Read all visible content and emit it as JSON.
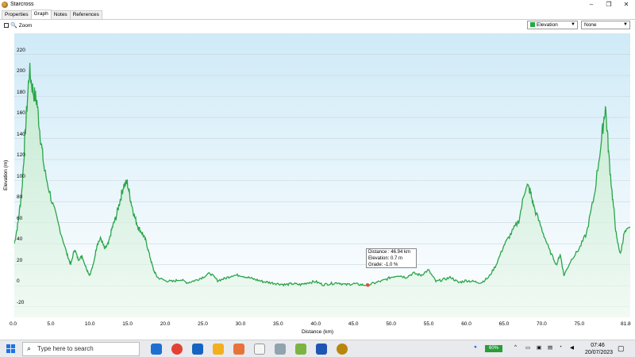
{
  "window": {
    "title": "Starcross"
  },
  "tabs": [
    {
      "label": "Properties"
    },
    {
      "label": "Graph"
    },
    {
      "label": "Notes"
    },
    {
      "label": "References"
    }
  ],
  "toolbar": {
    "zoom_label": "Zoom",
    "series_select": {
      "value": "Elevation",
      "color": "#22aa44"
    },
    "secondary_select": {
      "value": "None"
    }
  },
  "chart_data": {
    "type": "area",
    "xlabel": "Distance  (km)",
    "ylabel": "Elevation (m)",
    "xlim": [
      0,
      81.8
    ],
    "ylim": [
      -30,
      240
    ],
    "x_ticks": [
      "0.0",
      "5.0",
      "10.0",
      "15.0",
      "20.0",
      "25.0",
      "30.0",
      "35.0",
      "40.0",
      "45.0",
      "50.0",
      "55.0",
      "60.0",
      "65.0",
      "70.0",
      "75.0",
      "81.8"
    ],
    "y_ticks": [
      "-20",
      "0",
      "20",
      "40",
      "60",
      "80",
      "100",
      "120",
      "140",
      "160",
      "180",
      "200",
      "220"
    ],
    "grid": true,
    "line_color": "#2aa54a",
    "series": [
      {
        "x": [
          0,
          0.5,
          1,
          1.5,
          2,
          2.5,
          3,
          3.5,
          4,
          5,
          6,
          7,
          7.5,
          8,
          8.5,
          9,
          9.5,
          10,
          10.5,
          11,
          11.5,
          12,
          12.5,
          13,
          13.5,
          14,
          14.5,
          15,
          15.5,
          16,
          16.5,
          17,
          17.5,
          18,
          18.5,
          19,
          20,
          21,
          22,
          23,
          24,
          25,
          26,
          27,
          28,
          29,
          30,
          31,
          32,
          33,
          34,
          35,
          36,
          37,
          38,
          39,
          40,
          41,
          42,
          43,
          44,
          45,
          46,
          46.94,
          48,
          49,
          50,
          51,
          52,
          53,
          54,
          55,
          56,
          57,
          58,
          59,
          60,
          61,
          62,
          63,
          64,
          65,
          66,
          67,
          68,
          68.5,
          69,
          70,
          71,
          72,
          72.5,
          73,
          74,
          75,
          76,
          77,
          78,
          78.5,
          79,
          79.5,
          80,
          80.5,
          81,
          81.8
        ],
        "y": [
          40,
          60,
          90,
          150,
          205,
          185,
          175,
          140,
          110,
          80,
          55,
          30,
          20,
          35,
          25,
          28,
          18,
          10,
          20,
          40,
          45,
          35,
          40,
          55,
          65,
          80,
          95,
          98,
          80,
          65,
          55,
          50,
          42,
          28,
          15,
          8,
          5,
          4,
          6,
          3,
          5,
          8,
          12,
          5,
          7,
          10,
          10,
          8,
          6,
          4,
          3,
          2,
          1,
          2,
          1,
          3,
          4,
          1,
          2,
          3,
          1,
          2,
          1,
          0.7,
          3,
          5,
          8,
          10,
          8,
          12,
          10,
          15,
          4,
          6,
          8,
          3,
          5,
          4,
          3,
          8,
          20,
          38,
          50,
          62,
          97,
          90,
          75,
          55,
          35,
          20,
          30,
          10,
          25,
          35,
          50,
          85,
          140,
          171,
          120,
          80,
          45,
          30,
          50,
          55
        ]
      }
    ],
    "tooltip": {
      "distance": "Distance : 46.94 km",
      "elevation": "Elevation: 0.7 m",
      "grade": "Grade: -1.0 %"
    }
  },
  "taskbar": {
    "search_placeholder": "Type here to search",
    "battery": "60%",
    "time": "07:46",
    "date": "20/07/2023"
  }
}
